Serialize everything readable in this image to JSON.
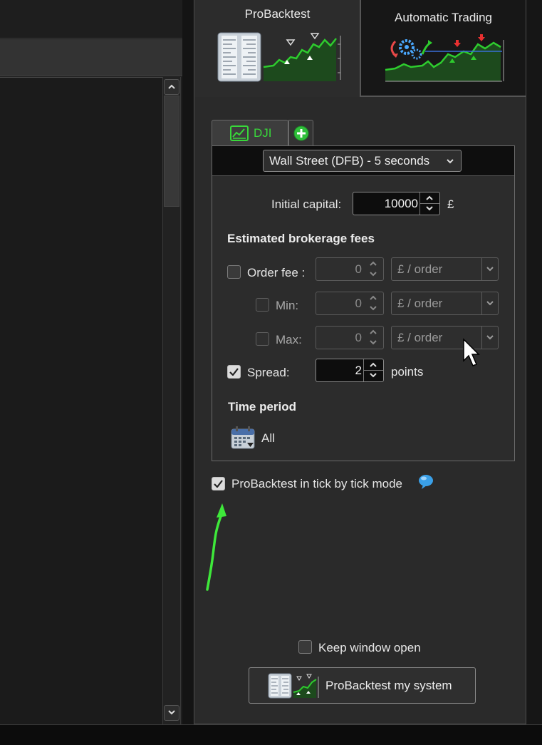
{
  "tabs": {
    "probacktest": "ProBacktest",
    "automatic_trading": "Automatic Trading"
  },
  "instrument": {
    "tab_label": "DJI",
    "timeframe": "Wall Street (DFB) - 5 seconds"
  },
  "capital": {
    "label": "Initial capital:",
    "value": "10000",
    "currency": "£"
  },
  "fees": {
    "heading": "Estimated brokerage fees",
    "order_fee_label": "Order fee :",
    "order_fee_value": "0",
    "order_fee_unit": "£ / order",
    "min_label": "Min:",
    "min_value": "0",
    "min_unit": "£ / order",
    "max_label": "Max:",
    "max_value": "0",
    "max_unit": "£ / order",
    "spread_label": "Spread:",
    "spread_value": "2",
    "spread_unit": "points",
    "spread_checked": true,
    "order_fee_checked": false,
    "min_checked": false,
    "max_checked": false
  },
  "time_period": {
    "heading": "Time period",
    "value": "All"
  },
  "tick_mode": {
    "label": "ProBacktest in tick by tick mode",
    "checked": true
  },
  "keep_open": {
    "label": "Keep window open",
    "checked": false
  },
  "run_button": "ProBacktest my system",
  "colors": {
    "accent_green": "#38d83a",
    "annotation_arrow": "#3ee83a",
    "info_blue": "#3aa0e8"
  }
}
